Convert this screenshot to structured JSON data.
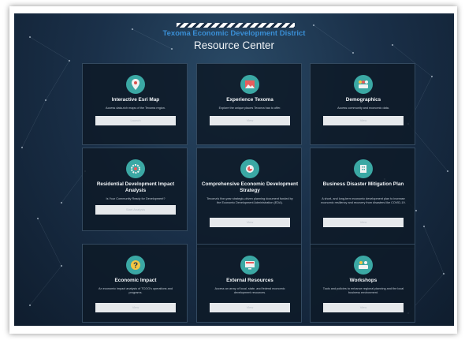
{
  "header": {
    "organization": "Texoma Economic Development District",
    "title": "Resource Center"
  },
  "colors": {
    "accent_blue": "#3a8fd6",
    "icon_teal": "#3ba8a4",
    "card_bg": "#0e1a28",
    "panel_bg": "#1a3049",
    "button_bg": "#e6e9ec"
  },
  "cards": [
    {
      "icon": "map-pin-icon",
      "title": "Interactive Esri Map",
      "description": "Access data-rich maps of the Texoma region.",
      "button": "Launch"
    },
    {
      "icon": "landscape-icon",
      "title": "Experience Texoma",
      "description": "Explore the unique places Texoma has to offer.",
      "button": "View"
    },
    {
      "icon": "people-icon",
      "title": "Demographics",
      "description": "Access community and economic data.",
      "button": "View"
    },
    {
      "icon": "gear-icon",
      "title": "Residential Development Impact Analysis",
      "description": "Is Your Community Ready for Development?",
      "button": "Start Analysis"
    },
    {
      "icon": "strategy-icon",
      "title": "Comprehensive Economic Development Strategy",
      "description": "Texoma's five-year strategic-driven planning document funded by the Economic Development Administration (EDA).",
      "button": "View"
    },
    {
      "icon": "building-icon",
      "title": "Business Disaster Mitigation Plan",
      "description": "A short- and long-term economic development plan to increase economic resiliency and recovery from disasters like COVID-19.",
      "button": "View"
    },
    {
      "icon": "question-icon",
      "title": "Economic Impact",
      "description": "An economic impact analysis of TCOG's operations and programs.",
      "button": "View"
    },
    {
      "icon": "monitor-icon",
      "title": "External Resources",
      "description": "Access an array of local, state, and federal economic development resources.",
      "button": "View"
    },
    {
      "icon": "handshake-icon",
      "title": "Workshops",
      "description": "Tools and policies to enhance regional planning and the local business environment.",
      "button": "View"
    }
  ]
}
